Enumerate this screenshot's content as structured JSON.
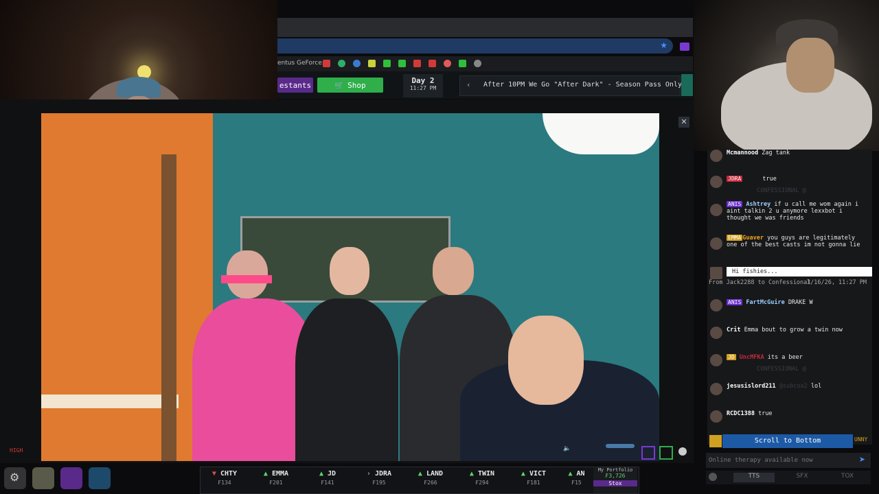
{
  "browser": {
    "bookmark_label": "entus GeForce..."
  },
  "game_bar": {
    "contestants_label": "estants",
    "shop_label": "Shop",
    "day_label": "Day 2",
    "time_label": "11:27 PM",
    "announcement": "After 10PM We Go \"After Dark\" - Season Pass Only"
  },
  "scene": {
    "quality_badge": "HIGH"
  },
  "chat": {
    "messages": [
      {
        "user": "Mcmannood",
        "text": "Zag tank",
        "tag": ""
      },
      {
        "user": "JDRA",
        "text": "true",
        "tag": "JDRA",
        "note": "CONFESSIONAL @"
      },
      {
        "user": "Ashtrey",
        "text": "if u call me wom again i aint talkin 2 u anymore lexxbot i thought we was friends",
        "tag": "ANIS"
      },
      {
        "user": "Guaver",
        "text": "you guys are legitimately one of the best casts im not gonna lie",
        "tag": "EMMA"
      },
      {
        "user": "Jack2288",
        "text": "Hi fishies...",
        "tag": "",
        "note": "From Jack2288 to Confessional",
        "time": "3/16/26, 11:27 PM"
      },
      {
        "user": "FartMcGuire",
        "text": "DRAKE W",
        "tag": "ANIS"
      },
      {
        "user": "Crit",
        "text": "Emma bout to grow a twin now",
        "tag": ""
      },
      {
        "user": "UncMFKA",
        "text": "its a beer",
        "tag": "JD",
        "note": "CONFESSIONAL @"
      },
      {
        "user": "jesusislord211",
        "text": "lol",
        "tag": "",
        "mention": "@subcoa2"
      },
      {
        "user": "RCDC1388",
        "text": "true",
        "tag": ""
      }
    ],
    "scroll_button": "Scroll to Bottom",
    "input_placeholder": "Online therapy available now",
    "tab_tts": "TTS",
    "tab_sfx": "SFX",
    "tab_tox": "TOX",
    "side_label": "UNNY"
  },
  "ticker": {
    "items": [
      {
        "name": "CHTY",
        "price": "₣134",
        "dir": "down"
      },
      {
        "name": "EMMA",
        "price": "₣201",
        "dir": "up"
      },
      {
        "name": "JD",
        "price": "₣141",
        "dir": "up"
      },
      {
        "name": "JDRA",
        "price": "₣195",
        "dir": "flat"
      },
      {
        "name": "LAND",
        "price": "₣266",
        "dir": "up"
      },
      {
        "name": "TWIN",
        "price": "₣294",
        "dir": "up"
      },
      {
        "name": "VICT",
        "price": "₣181",
        "dir": "up"
      },
      {
        "name": "AN",
        "price": "₣15",
        "dir": "up"
      }
    ],
    "portfolio_label": "My Portfolio",
    "portfolio_value": "₣3,726",
    "stox_label": "Stox"
  },
  "colors": {
    "accent_green": "#2fae4a",
    "ticker_up": "#5fd36f",
    "ticker_down": "#e04a4a",
    "chat_tag_purple": "#6a2fd0",
    "chat_tag_red": "#c42a3a"
  }
}
